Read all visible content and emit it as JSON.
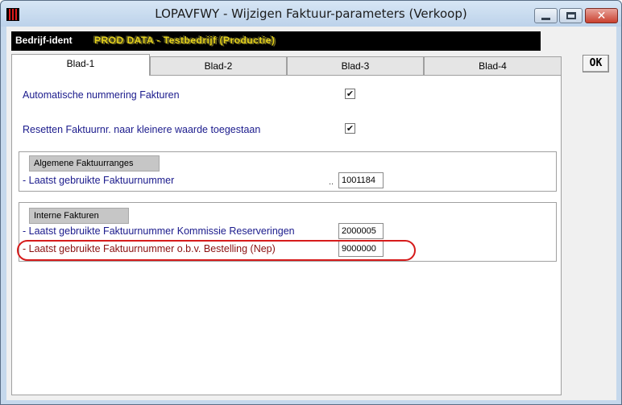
{
  "window": {
    "title": "LOPAVFWY - Wijzigen Faktuur-parameters (Verkoop)",
    "minimize_icon": "minimize-icon",
    "maximize_icon": "maximize-icon",
    "close_icon": "close-icon",
    "close_glyph": "✕"
  },
  "ident": {
    "label": "Bedrijf-ident",
    "value": "PROD DATA - Testbedrijf (Productie)"
  },
  "ok_button": {
    "label": "OK"
  },
  "tabs": [
    {
      "label": "Blad-1",
      "active": true
    },
    {
      "label": "Blad-2",
      "active": false
    },
    {
      "label": "Blad-3",
      "active": false
    },
    {
      "label": "Blad-4",
      "active": false
    }
  ],
  "options": [
    {
      "label": "Automatische nummering Fakturen",
      "checked": true
    },
    {
      "label": "Resetten Faktuurnr. naar kleinere waarde toegestaan",
      "checked": true
    }
  ],
  "check_glyph": "✔",
  "groups": {
    "algemene": {
      "title": "Algemene Faktuurranges",
      "fields": [
        {
          "label": "- Laatst gebruikte Faktuurnummer",
          "dots": "..",
          "value": "1001184"
        }
      ]
    },
    "interne": {
      "title": "Interne Fakturen",
      "fields": [
        {
          "label": "- Laatst gebruikte Faktuurnummer Kommissie Reserveringen",
          "value": "2000005"
        },
        {
          "label": "- Laatst gebruikte Faktuurnummer o.b.v. Bestelling (Nep)",
          "value": "9000000"
        }
      ]
    }
  },
  "colors": {
    "label_text": "#1a1a8c",
    "highlight_text": "#8a1010",
    "annotation_ellipse": "#d61b1b",
    "ident_value": "#e6d21c"
  }
}
